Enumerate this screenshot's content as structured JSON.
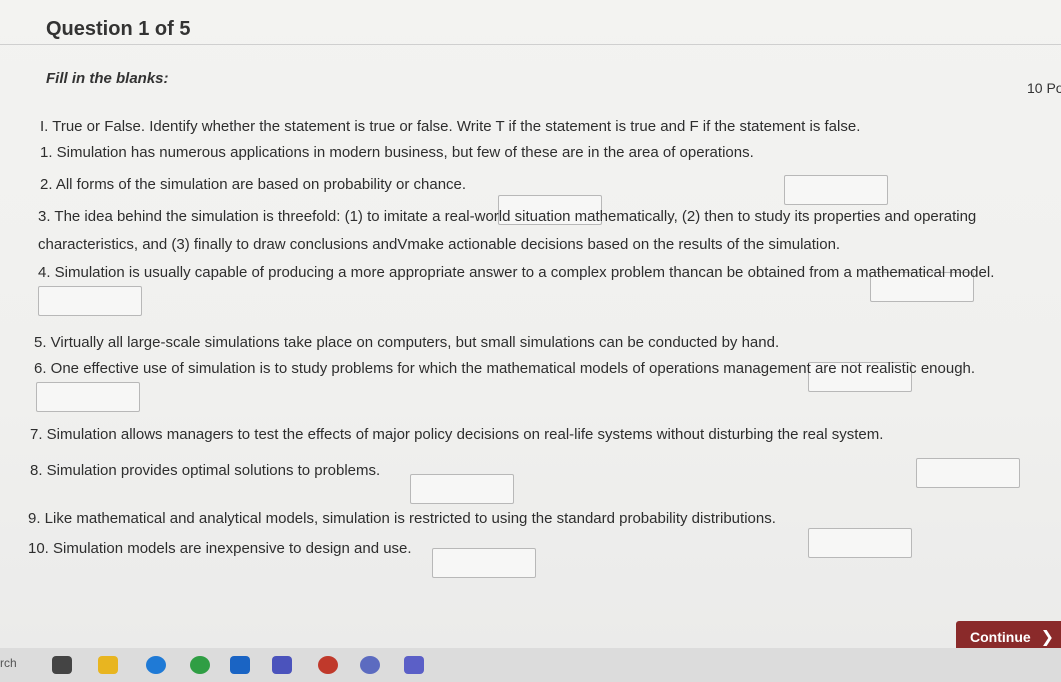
{
  "question_header": "Question 1 of 5",
  "instruction_label": "Fill in the blanks:",
  "points_label": "10 Po",
  "intro_text": "I. True or False. Identify whether the statement is true or false. Write T if the statement is true and F if the statement is false.",
  "statements": {
    "s1": "1. Simulation has numerous applications in modern business, but few of these are in the area of operations.",
    "s2": "2. All forms of the simulation are based on probability or chance.",
    "s3a": "3. The idea behind the simulation is threefold: (1) to imitate a real-world situation mathematically, (2) then to study its properties and operating",
    "s3b": "characteristics, and (3) finally to draw conclusions andVmake actionable decisions based on the results of the simulation.",
    "s4": "4. Simulation is usually capable of producing a more appropriate answer to a complex problem thancan be obtained from a mathematical model.",
    "s5": "5. Virtually all large-scale simulations take place on computers, but small simulations can be conducted by hand.",
    "s6": "6. One effective use of simulation is to study problems for which the mathematical models of operations management are not realistic enough.",
    "s7": "7. Simulation allows managers to test the effects of major policy decisions on real-life systems without disturbing the real system.",
    "s8": "8. Simulation provides optimal solutions to problems.",
    "s9": "9. Like mathematical and analytical models, simulation is restricted to using the standard probability distributions.",
    "s10": "10. Simulation models are inexpensive to design and use."
  },
  "answers": {
    "a1": "",
    "a2": "",
    "a3": "",
    "a4": "",
    "a5": "",
    "a6": "",
    "a7": "",
    "a8": "",
    "a9": "",
    "a10": ""
  },
  "continue_button": {
    "label": "Continue",
    "chevron": "❯"
  },
  "taskbar": {
    "search_text": "rch",
    "icons": [
      "task-view-icon",
      "file-explorer-icon",
      "edge-icon",
      "chrome-icon",
      "outlook-icon",
      "teams-icon",
      "wps-icon",
      "copilot-icon",
      "teams-chat-icon"
    ]
  },
  "colors": {
    "accent": "#8a2a2a",
    "page_bg": "#f0f0ee",
    "blank_border": "#b8b8b8"
  }
}
